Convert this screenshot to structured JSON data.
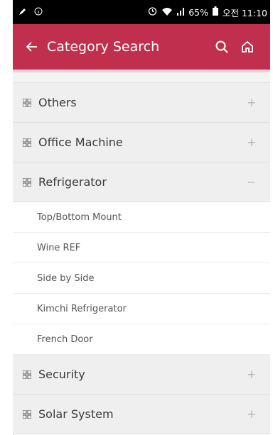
{
  "status_bar": {
    "left_icons": [
      "pen-icon",
      "info-icon"
    ],
    "battery_percent": "65%",
    "time": "오전 11:10"
  },
  "app_bar": {
    "title": "Category Search",
    "back_icon": "back-arrow-icon",
    "search_icon": "search-icon",
    "home_icon": "home-icon",
    "color": "#c0304e"
  },
  "categories": [
    {
      "label": "Others",
      "sign": "+"
    },
    {
      "label": "Office Machine",
      "sign": "+"
    },
    {
      "label": "Refrigerator",
      "sign": "−",
      "expanded": true,
      "children": [
        "Top/Bottom Mount",
        "Wine REF",
        "Side by Side",
        "Kimchi Refrigerator",
        "French Door"
      ]
    },
    {
      "label": "Security",
      "sign": "+"
    },
    {
      "label": "Solar System",
      "sign": "+"
    }
  ]
}
